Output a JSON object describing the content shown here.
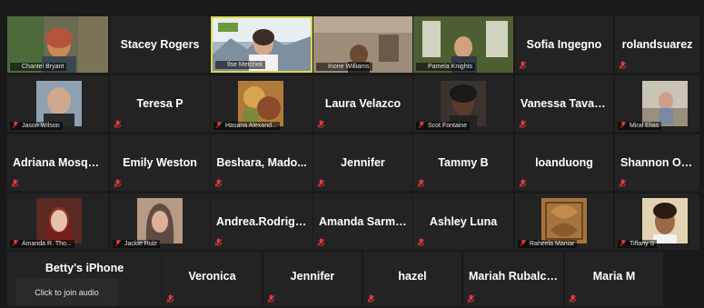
{
  "join_audio": {
    "label": "Click to join audio"
  },
  "tiles": [
    {
      "id": "chantel",
      "label": "Chantel Bryant"
    },
    {
      "id": "stacey",
      "name": "Stacey Rogers"
    },
    {
      "id": "ilse",
      "label": "Ilse Metchek"
    },
    {
      "id": "inone",
      "label": "Inone Williams"
    },
    {
      "id": "pamela",
      "label": "Pamela Knights"
    },
    {
      "id": "sofia",
      "name": "Sofia Ingegno"
    },
    {
      "id": "rolandsuarez",
      "name": "rolandsuarez"
    },
    {
      "id": "jason",
      "label": "Jason Wilson"
    },
    {
      "id": "teresa",
      "name": "Teresa P"
    },
    {
      "id": "hasana",
      "label": "Hasana Alexand..."
    },
    {
      "id": "laura",
      "name": "Laura Velazco"
    },
    {
      "id": "scot",
      "label": "Scot Fontaine"
    },
    {
      "id": "vanessa",
      "name": "Vanessa Tavarez"
    },
    {
      "id": "miral",
      "label": "Miral Elias"
    },
    {
      "id": "adriana",
      "name": "Adriana  Mosqu..."
    },
    {
      "id": "emily",
      "name": "Emily Weston"
    },
    {
      "id": "beshara",
      "name": "Beshara,  Mado..."
    },
    {
      "id": "jennifer1",
      "name": "Jennifer"
    },
    {
      "id": "tammy",
      "name": "Tammy B"
    },
    {
      "id": "loanduong",
      "name": "loanduong"
    },
    {
      "id": "shannon",
      "name": "Shannon Ortiz"
    },
    {
      "id": "amanda",
      "label": "Amanda R. Tho..."
    },
    {
      "id": "jackie",
      "label": "Jackie Ruiz"
    },
    {
      "id": "andrea",
      "name": "Andrea.Rodrigu..."
    },
    {
      "id": "amandasarmie",
      "name": "Amanda  Sarmie..."
    },
    {
      "id": "ashley",
      "name": "Ashley Luna"
    },
    {
      "id": "raheela",
      "label": "Raheela Maniar"
    },
    {
      "id": "tiffany",
      "label": "Tiffany S"
    },
    {
      "id": "betty",
      "name": "Betty's iPhone"
    },
    {
      "id": "veronica",
      "name": "Veronica"
    },
    {
      "id": "jennifer2",
      "name": "Jennifer"
    },
    {
      "id": "hazel",
      "name": "hazel"
    },
    {
      "id": "mariah",
      "name": "Mariah Rubalcava"
    },
    {
      "id": "maria",
      "name": "Maria M"
    }
  ],
  "colors": {
    "mic_muted": "#e03b3b",
    "active_border": "#d8d84a",
    "tile_bg": "#232323"
  },
  "icons": {
    "mic": "mic-muted-icon"
  }
}
